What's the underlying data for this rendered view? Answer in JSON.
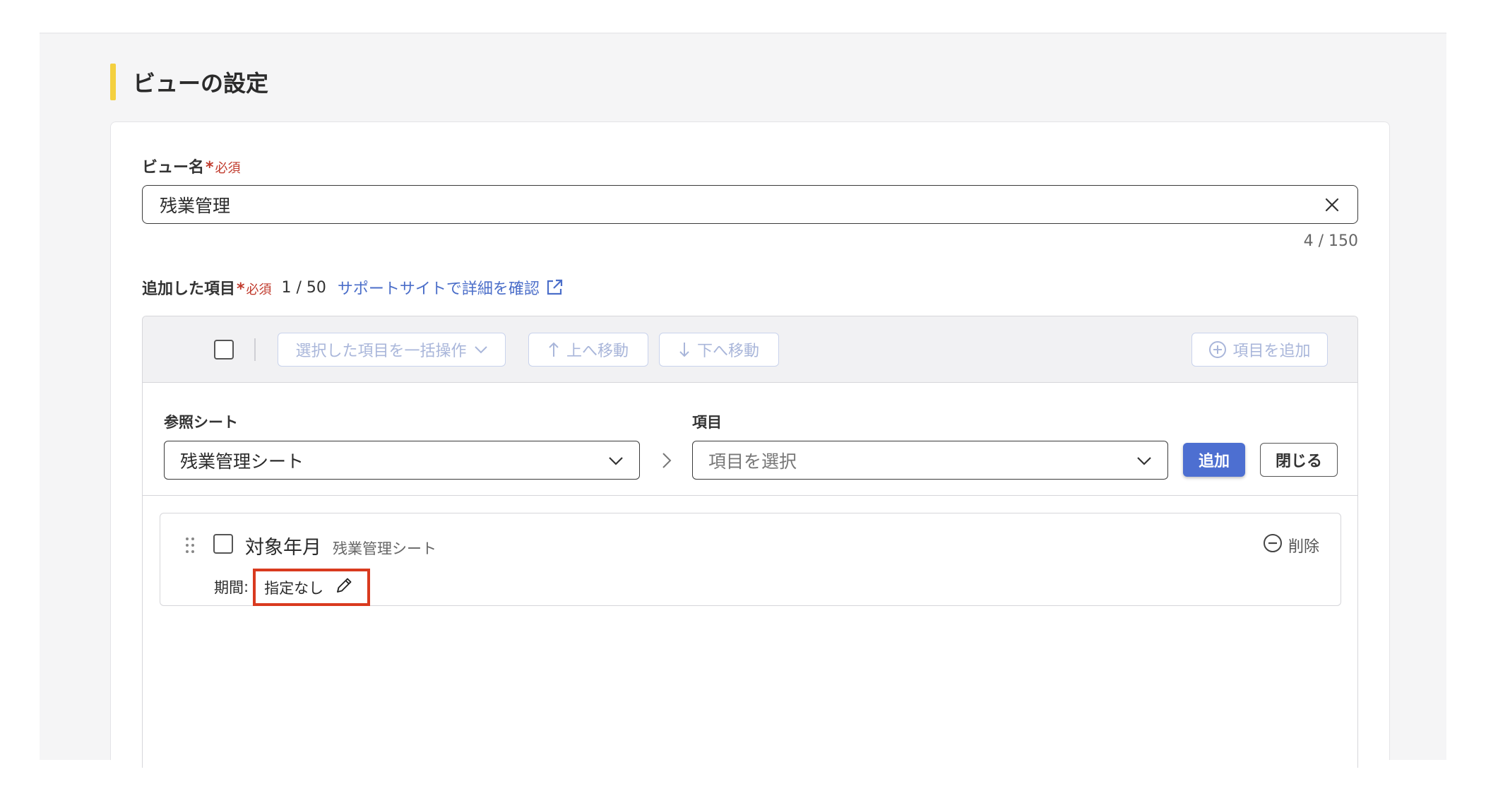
{
  "section": {
    "title": "ビューの設定"
  },
  "view_name": {
    "label": "ビュー名",
    "asterisk": "*",
    "required": "必須",
    "value": "残業管理",
    "counter": "4 / 150"
  },
  "items_section": {
    "label": "追加した項目",
    "asterisk": "*",
    "required": "必須",
    "count": "1 / 50",
    "support_link": "サポートサイトで詳細を確認"
  },
  "toolbar": {
    "bulk_action": "選択した項目を一括操作",
    "move_up": "上へ移動",
    "move_down": "下へ移動",
    "add_item": "項目を追加"
  },
  "selector": {
    "sheet_label": "参照シート",
    "sheet_value": "残業管理シート",
    "item_label": "項目",
    "item_placeholder": "項目を選択",
    "add_button": "追加",
    "close_button": "閉じる"
  },
  "items": [
    {
      "name": "対象年月",
      "sheet": "残業管理シート",
      "period_label": "期間",
      "period_colon": ":",
      "period_value": "指定なし",
      "delete_label": "削除"
    }
  ],
  "colors": {
    "accent_yellow": "#f4d03f",
    "primary_blue": "#4d6fd1",
    "link_blue": "#4b6ec9",
    "required_red": "#c0392b",
    "highlight_red": "#d93a1f"
  }
}
